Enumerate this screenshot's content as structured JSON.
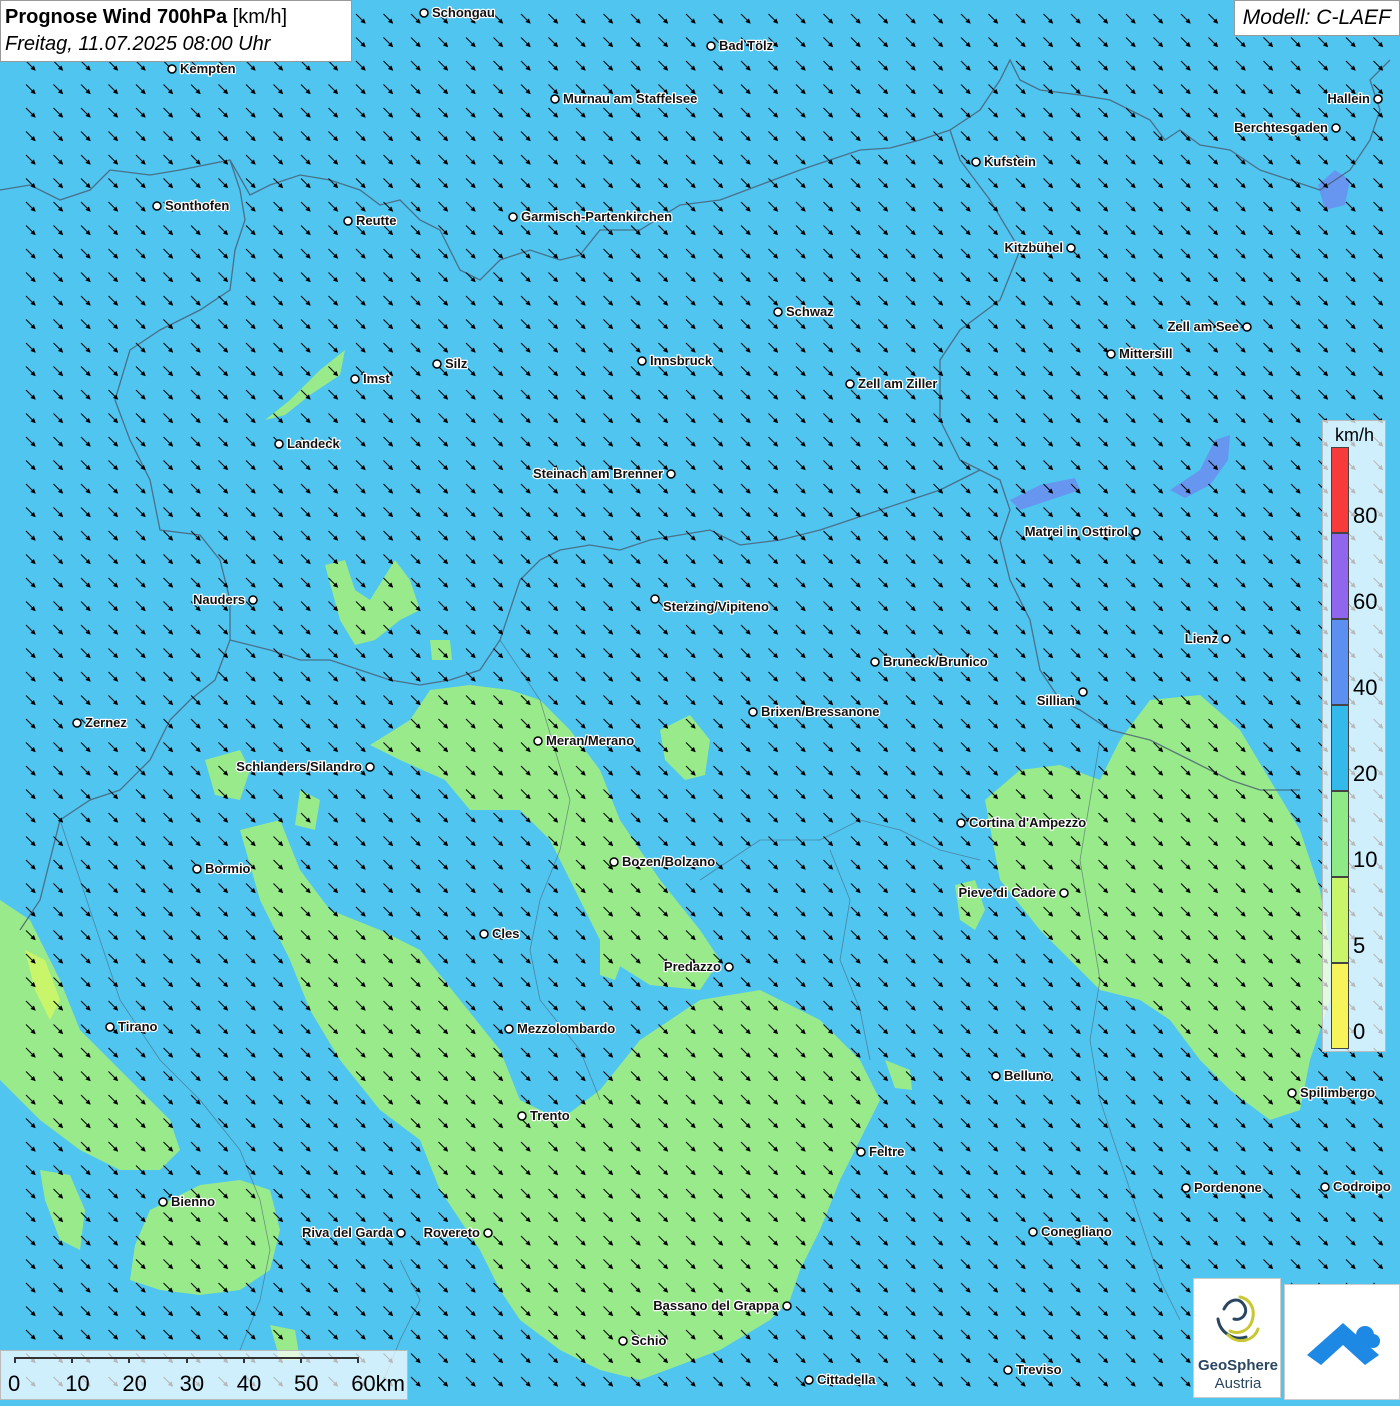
{
  "header": {
    "title_bold": "Prognose Wind 700hPa",
    "title_unit": "[km/h]",
    "datetime": "Freitag, 11.07.2025 08:00 Uhr",
    "model": "Modell: C-LAEF"
  },
  "legend": {
    "unit": "km/h",
    "classes": [
      {
        "value": "0",
        "color": "#f7f35a"
      },
      {
        "value": "5",
        "color": "#c9f56a"
      },
      {
        "value": "10",
        "color": "#8eea86"
      },
      {
        "value": "20",
        "color": "#33b9ea"
      },
      {
        "value": "40",
        "color": "#5b8ff0"
      },
      {
        "value": "60",
        "color": "#9166ef"
      },
      {
        "value": "80",
        "color": "#f73a3a"
      }
    ]
  },
  "scalebar": {
    "labels": [
      "0",
      "10",
      "20",
      "30",
      "40",
      "50",
      "60km"
    ]
  },
  "logos": {
    "geosphere_line1": "GeoSphere",
    "geosphere_line2": "Austria"
  },
  "colors": {
    "background_wind": "#4fc5f0",
    "low_wind": "#98ea8a",
    "moderate_wind": "#6b8df0",
    "border": "#4a5a70",
    "arrow": "#000000"
  },
  "map": {
    "wind_direction": "northwest",
    "cities": [
      {
        "name": "Schongau"
      },
      {
        "name": "Bad Tölz"
      },
      {
        "name": "Kempten"
      },
      {
        "name": "Murnau am Staffelsee"
      },
      {
        "name": "Hallein"
      },
      {
        "name": "Berchtesgaden"
      },
      {
        "name": "Kufstein"
      },
      {
        "name": "Sonthofen"
      },
      {
        "name": "Reutte"
      },
      {
        "name": "Garmisch-Partenkirchen"
      },
      {
        "name": "Kitzbühel"
      },
      {
        "name": "Schwaz"
      },
      {
        "name": "Zell am See"
      },
      {
        "name": "Mittersill"
      },
      {
        "name": "Silz"
      },
      {
        "name": "Innsbruck"
      },
      {
        "name": "Imst"
      },
      {
        "name": "Zell am Ziller"
      },
      {
        "name": "Landeck"
      },
      {
        "name": "Steinach am Brenner"
      },
      {
        "name": "Matrei in Osttirol"
      },
      {
        "name": "Nauders"
      },
      {
        "name": "Sterzing/Vipiteno"
      },
      {
        "name": "Lienz"
      },
      {
        "name": "Bruneck/Brunico"
      },
      {
        "name": "Sillian"
      },
      {
        "name": "Zernez"
      },
      {
        "name": "Brixen/Bressanone"
      },
      {
        "name": "Meran/Merano"
      },
      {
        "name": "Schlanders/Silandro"
      },
      {
        "name": "Cortina d'Ampezzo"
      },
      {
        "name": "Bormio"
      },
      {
        "name": "Bozen/Bolzano"
      },
      {
        "name": "Pieve di Cadore"
      },
      {
        "name": "Cles"
      },
      {
        "name": "Predazzo"
      },
      {
        "name": "Tirano"
      },
      {
        "name": "Mezzolombardo"
      },
      {
        "name": "Belluno"
      },
      {
        "name": "Spilimbergo"
      },
      {
        "name": "Trento"
      },
      {
        "name": "Feltre"
      },
      {
        "name": "Bienno"
      },
      {
        "name": "Pordenone"
      },
      {
        "name": "Codroipo"
      },
      {
        "name": "Riva del Garda"
      },
      {
        "name": "Rovereto"
      },
      {
        "name": "Conegliano"
      },
      {
        "name": "Bassano del Grappa"
      },
      {
        "name": "Schio"
      },
      {
        "name": "Treviso"
      },
      {
        "name": "Cittadella"
      }
    ]
  }
}
